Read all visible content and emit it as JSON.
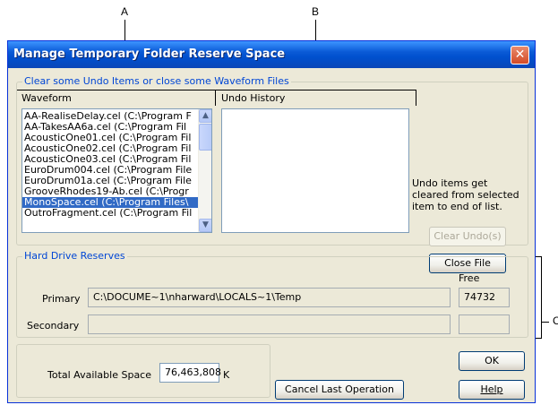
{
  "callouts": {
    "a": "A",
    "b": "B",
    "c": "C"
  },
  "window": {
    "title": "Manage Temporary Folder Reserve Space",
    "close_glyph": "✕"
  },
  "clear_group": {
    "legend": "Clear some Undo Items or close some Waveform Files",
    "waveform_header": "Waveform",
    "undo_header": "Undo History",
    "waveform_items": [
      "AA-RealiseDelay.cel (C:\\Program F",
      "AA-TakesAA6a.cel (C:\\Program Fil",
      "AcousticOne01.cel (C:\\Program Fil",
      "AcousticOne02.cel (C:\\Program Fil",
      "AcousticOne03.cel (C:\\Program Fil",
      "EuroDrum004.cel (C:\\Program File",
      "EuroDrum01a.cel (C:\\Program File",
      "GrooveRhodes19-Ab.cel (C:\\Progr",
      "MonoSpace.cel (C:\\Program Files\\",
      "OutroFragment.cel (C:\\Program Fil"
    ],
    "selected_index": 8,
    "note": "Undo items get cleared from selected item to end of list.",
    "clear_undo_label": "Clear Undo(s)",
    "close_file_label": "Close File"
  },
  "hard_drive": {
    "legend": "Hard Drive Reserves",
    "free_header": "Free",
    "primary_label": "Primary",
    "primary_path": "C:\\DOCUME~1\\nharward\\LOCALS~1\\Temp",
    "primary_free": "74732",
    "secondary_label": "Secondary",
    "secondary_path": "",
    "secondary_free": ""
  },
  "total": {
    "label": "Total Available Space",
    "value": "76,463,808",
    "unit": "K"
  },
  "buttons": {
    "cancel_last": "Cancel Last Operation",
    "ok": "OK",
    "help": "Help"
  }
}
